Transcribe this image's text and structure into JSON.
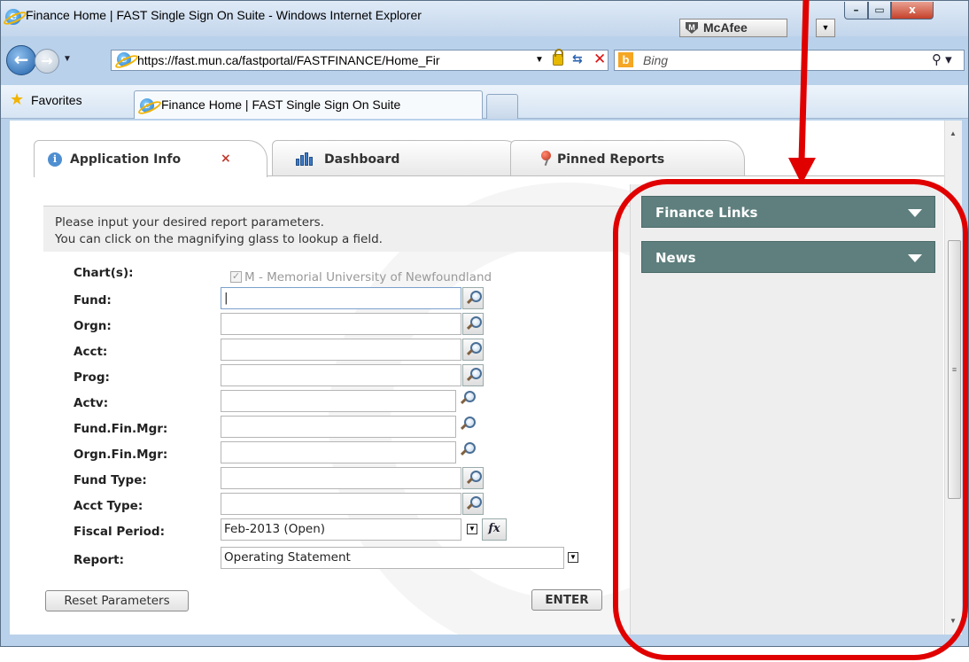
{
  "window": {
    "title": "Finance Home | FAST Single Sign On Suite - Windows Internet Explorer",
    "mcafee_label": "McAfee",
    "minimize_glyph": "–",
    "maximize_glyph": "▭",
    "close_glyph": "x"
  },
  "navigation": {
    "url": "https://fast.mun.ca/fastportal/FASTFINANCE/Home_Fir",
    "search_placeholder": "Bing",
    "back_icon": "back-arrow-icon",
    "forward_icon": "forward-arrow-icon"
  },
  "favorites_bar": {
    "favorites_label": "Favorites",
    "tab_label": "Finance Home | FAST Single Sign On Suite"
  },
  "portal_tabs": [
    {
      "label": "Application Info",
      "icon": "info-icon",
      "active": true
    },
    {
      "label": "Dashboard",
      "icon": "bar-chart-icon",
      "active": false
    },
    {
      "label": "Pinned Reports",
      "icon": "pin-icon",
      "active": false
    }
  ],
  "instructions": {
    "line1": "Please input your desired report parameters.",
    "line2": "You can click on the magnifying glass to lookup a field."
  },
  "form": {
    "chart_label": "Chart(s):",
    "chart_value": "M - Memorial University of Newfoundland",
    "chart_checked": true,
    "fields": [
      {
        "label": "Fund:",
        "value": "|"
      },
      {
        "label": "Orgn:",
        "value": ""
      },
      {
        "label": "Acct:",
        "value": ""
      },
      {
        "label": "Prog:",
        "value": ""
      },
      {
        "label": "Actv:",
        "value": ""
      },
      {
        "label": "Fund.Fin.Mgr:",
        "value": ""
      },
      {
        "label": "Orgn.Fin.Mgr:",
        "value": ""
      },
      {
        "label": "Fund Type:",
        "value": ""
      },
      {
        "label": "Acct Type:",
        "value": ""
      }
    ],
    "fiscal_period_label": "Fiscal Period:",
    "fiscal_period_value": "Feb-2013 (Open)",
    "fx_label": "fx",
    "report_label": "Report:",
    "report_value": "Operating Statement",
    "reset_button": "Reset Parameters",
    "enter_button": "ENTER"
  },
  "right_panel": {
    "sections": [
      {
        "label": "Finance Links"
      },
      {
        "label": "News"
      }
    ]
  },
  "colors": {
    "section_header_bg": "#5e7f7d",
    "annotation_red": "#e00000",
    "tab_close_red": "#c0392b"
  }
}
